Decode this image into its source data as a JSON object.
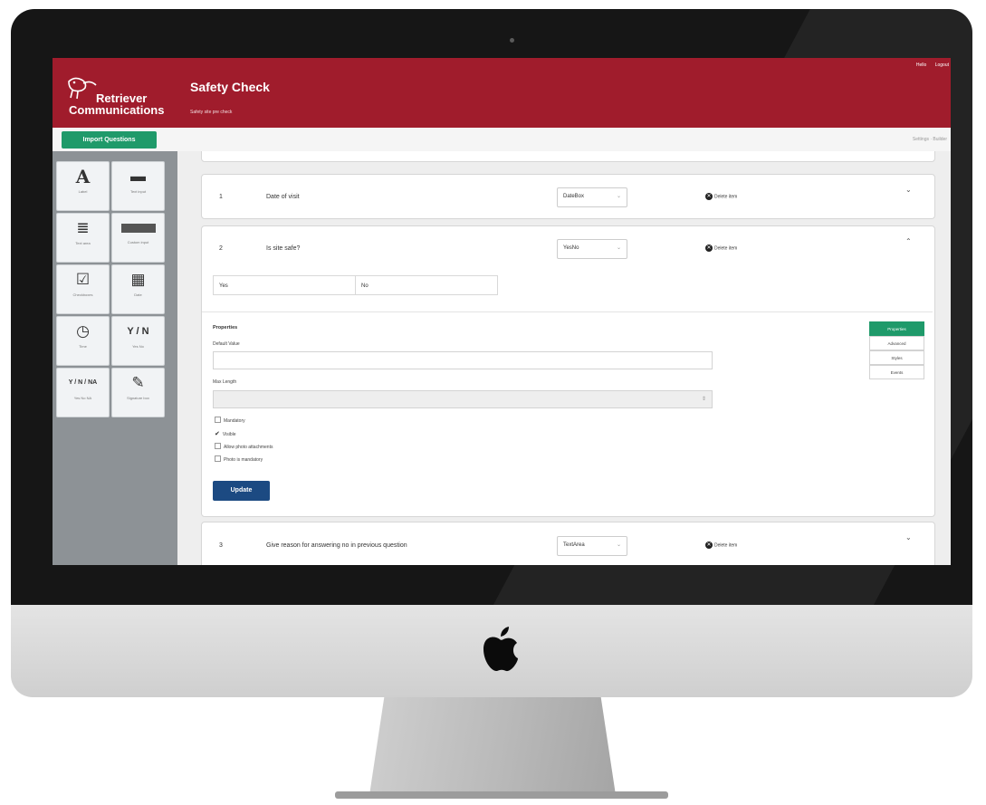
{
  "brand": {
    "name_line1": "Retriever",
    "name_line2": "Communications"
  },
  "header": {
    "title": "Safety Check",
    "subtitle": "Safety site pre check",
    "links": [
      "Hello",
      "Logout"
    ]
  },
  "toolbar": {
    "import_label": "Import Questions",
    "crumb": "Settings · Builder"
  },
  "tools": [
    {
      "glyph": "A",
      "label": "Label"
    },
    {
      "glyph": "▬",
      "label": "Text input"
    },
    {
      "glyph": "≣",
      "label": "Text area"
    },
    {
      "glyph": "",
      "label": "Custom input"
    },
    {
      "glyph": "☑",
      "label": "Checkboxes"
    },
    {
      "glyph": "▦",
      "label": "Date"
    },
    {
      "glyph": "◷",
      "label": "Time"
    },
    {
      "glyph": "Y / N",
      "label": "Yes No"
    },
    {
      "glyph": "Y / N / NA",
      "label": "Yes No NA"
    },
    {
      "glyph": "✎",
      "label": "Signature box"
    }
  ],
  "questions": [
    {
      "num": "1",
      "text": "Date of visit",
      "type": "DateBox",
      "delete_label": "Delete item",
      "chevron": "⌄"
    },
    {
      "num": "2",
      "text": "Is site safe?",
      "type": "YesNo",
      "delete_label": "Delete item",
      "chevron": "⌃",
      "answers": [
        "Yes",
        "No"
      ],
      "properties": {
        "title": "Properties",
        "default_value_label": "Default Value",
        "max_length_label": "Max Length",
        "max_length_spin": "⇕",
        "checkboxes": [
          {
            "label": "Mandatory",
            "checked": "false"
          },
          {
            "label": "Visible",
            "checked": "true"
          },
          {
            "label": "Allow photo attachments",
            "checked": "false"
          },
          {
            "label": "Photo is mandatory",
            "checked": "false"
          }
        ],
        "update_label": "Update",
        "tabs": [
          "Properties",
          "Advanced",
          "Styles",
          "Events"
        ]
      }
    },
    {
      "num": "3",
      "text": "Give reason for answering no in previous question",
      "type": "TextArea",
      "delete_label": "Delete item",
      "chevron": "⌄"
    }
  ]
}
